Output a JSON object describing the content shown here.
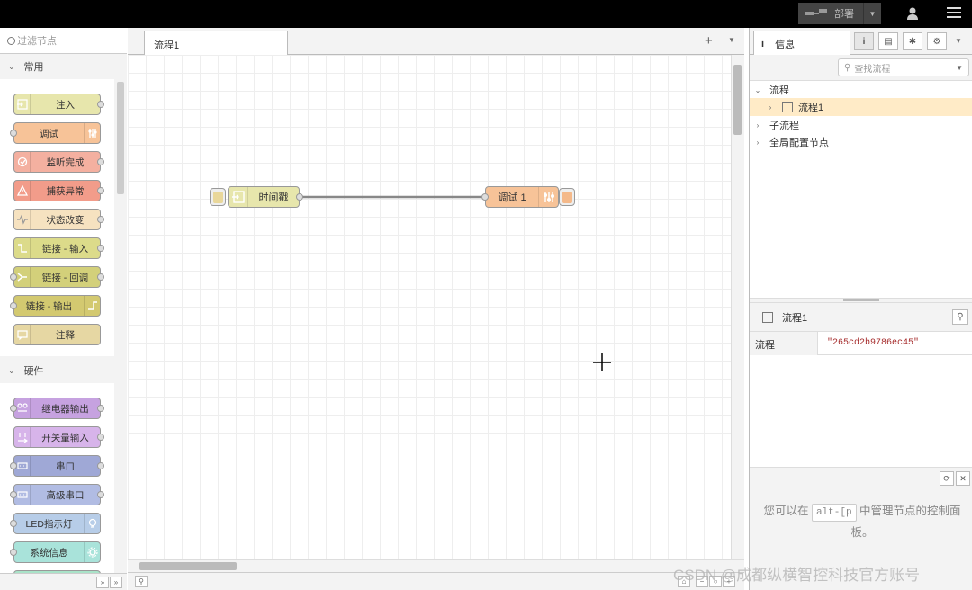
{
  "header": {
    "deploy_label": "部署",
    "menu_icon": "hamburger-menu-icon",
    "user_icon": "user-icon"
  },
  "palette": {
    "search_placeholder": "过滤节点",
    "categories": [
      {
        "name": "常用",
        "nodes": [
          {
            "label": "注入",
            "color": "#e7e6ac",
            "icon": "arrow-in-icon"
          },
          {
            "label": "调试",
            "color": "#87a980",
            "icon": "debug-icon"
          },
          {
            "label": "监听完成",
            "color": "#c0edc0",
            "icon": "complete-icon"
          },
          {
            "label": "捕获异常",
            "color": "#e9967a",
            "icon": "alert-icon"
          },
          {
            "label": "状态改变",
            "color": "#c0c0c0",
            "icon": "status-icon"
          },
          {
            "label": "链接 - 输入",
            "color": "#dddddd",
            "icon": "link-in-icon"
          },
          {
            "label": "链接 - 回调",
            "color": "#dddddd",
            "icon": "link-call-icon"
          },
          {
            "label": "链接 - 输出",
            "color": "#dddddd",
            "icon": "link-out-icon"
          },
          {
            "label": "注释",
            "color": "#ffffff",
            "icon": "comment-icon"
          }
        ]
      },
      {
        "name": "硬件",
        "nodes": [
          {
            "label": "继电器输出",
            "icon": "relay-icon"
          },
          {
            "label": "开关量输入",
            "icon": "switch-input-icon"
          },
          {
            "label": "串口",
            "icon": "serial-icon"
          },
          {
            "label": "高级串口",
            "icon": "serial-advanced-icon"
          },
          {
            "label": "LED指示灯",
            "icon": "bulb-icon"
          },
          {
            "label": "系统信息",
            "icon": "gear-icon"
          }
        ]
      }
    ]
  },
  "workspace": {
    "tab_label": "流程1",
    "nodes": [
      {
        "label": "时间戳",
        "type": "inject"
      },
      {
        "label": "调试 1",
        "type": "debug"
      }
    ]
  },
  "sidebar": {
    "tab_label": "信息",
    "search_placeholder": "查找流程",
    "tree": [
      {
        "label": "流程",
        "expanded": true
      },
      {
        "label": "流程1",
        "selected": true
      },
      {
        "label": "子流程",
        "expanded": false
      },
      {
        "label": "全局配置节点",
        "expanded": false
      }
    ],
    "props_title": "流程1",
    "props_key": "流程",
    "props_value": "\"265cd2b9786ec45\"",
    "help_before": "您可以在",
    "help_kbd": "alt-[p",
    "help_after": "中管理节点的控制面板。"
  },
  "watermark": "CSDN @成都纵横智控科技官方账号"
}
